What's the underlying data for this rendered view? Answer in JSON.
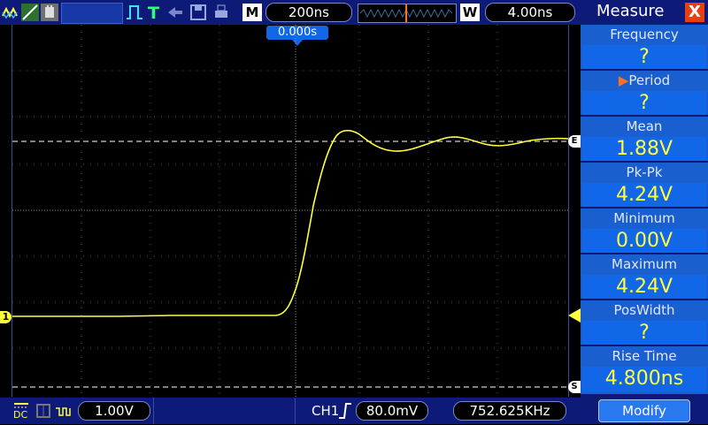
{
  "top": {
    "m_label": "M",
    "timebase": "200ns",
    "w_label": "W",
    "window_time": "4.00ns",
    "trigger_marker": "0.000s"
  },
  "bottom": {
    "coupling": "DC",
    "volts_div": "1.00V",
    "channel": "CH1",
    "trigger_level": "80.0mV",
    "frequency": "752.625KHz"
  },
  "markers": {
    "ch1_marker": "1",
    "upper_cursor": "E",
    "lower_cursor": "S"
  },
  "measure": {
    "title": "Measure",
    "close": "X",
    "selected_indicator": "▶",
    "items": [
      {
        "label": "Frequency",
        "value": "?"
      },
      {
        "label": "Period",
        "value": "?"
      },
      {
        "label": "Mean",
        "value": "1.88V"
      },
      {
        "label": "Pk-Pk",
        "value": "4.24V"
      },
      {
        "label": "Minimum",
        "value": "0.00V"
      },
      {
        "label": "Maximum",
        "value": "4.24V"
      },
      {
        "label": "PosWidth",
        "value": "?"
      },
      {
        "label": "Rise Time",
        "value": "4.800ns"
      }
    ],
    "modify_label": "Modify"
  },
  "colors": {
    "trace": "#ffff40",
    "panel": "#1a5fd0",
    "toolbar": "#0d1a78"
  }
}
